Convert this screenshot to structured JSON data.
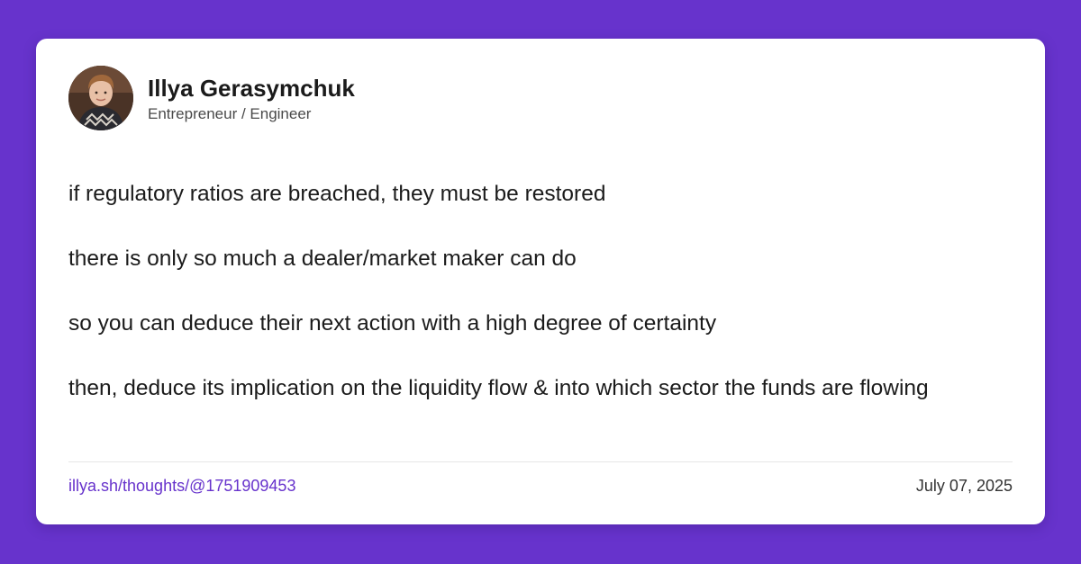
{
  "author": {
    "name": "Illya Gerasymchuk",
    "title": "Entrepreneur / Engineer"
  },
  "post": {
    "paragraphs": [
      "if regulatory ratios are breached, they must be restored",
      "there is only so much a dealer/market maker can do",
      "so you can deduce their next action with a high degree of certainty",
      "then, deduce its implication on the liquidity flow & into which sector the funds are flowing"
    ]
  },
  "footer": {
    "link": "illya.sh/thoughts/@1751909453",
    "date": "July 07, 2025"
  },
  "colors": {
    "background": "#6733cc",
    "card": "#ffffff",
    "accent": "#6733cc"
  }
}
